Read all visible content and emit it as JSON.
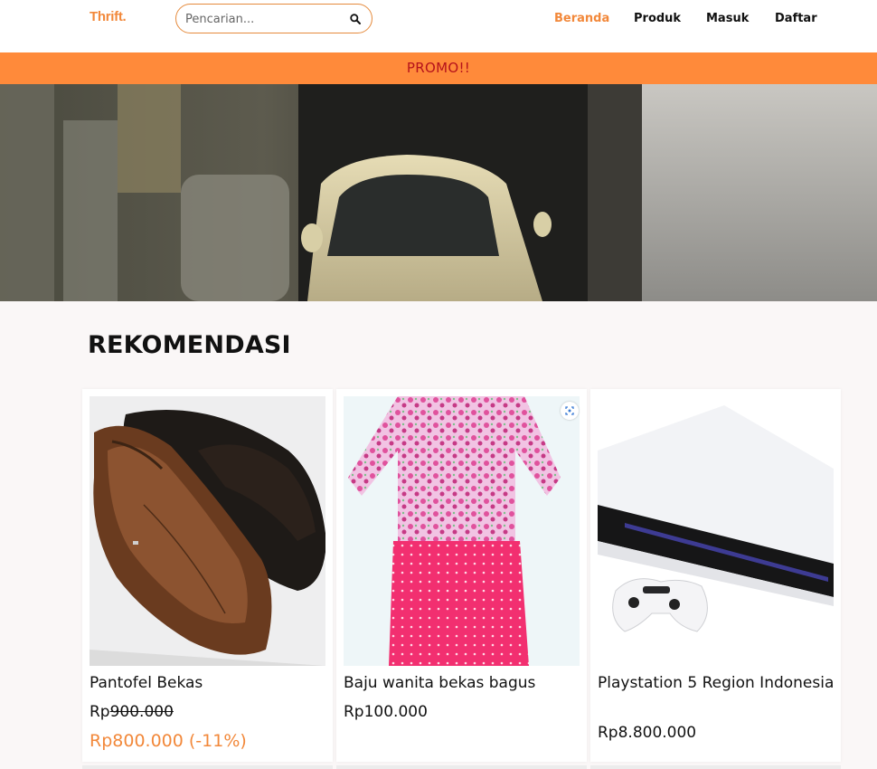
{
  "navbar": {
    "logo": "Thrift.",
    "search_placeholder": "Pencarian...",
    "links": [
      "Beranda",
      "Produk",
      "Masuk",
      "Daftar"
    ],
    "active": "Beranda"
  },
  "promo": {
    "label": "PROMO!!"
  },
  "section": {
    "title": "REKOMENDASI"
  },
  "products": [
    {
      "name": "Pantofel Bekas",
      "price_currency": "Rp",
      "price_original_amount": "900.000",
      "price_sale": "Rp800.000 (-11%)"
    },
    {
      "name": "Baju wanita bekas bagus",
      "price": "Rp100.000"
    },
    {
      "name": "Playstation 5 Region Indonesia",
      "price": "Rp8.800.000"
    }
  ],
  "colors": {
    "accent": "#f2883a",
    "promo_bg": "#ff8a3a",
    "promo_text": "#b5121b",
    "page_bg": "#faf7f7"
  },
  "icons": {
    "search": "search-icon",
    "image_scan": "scan-icon"
  }
}
